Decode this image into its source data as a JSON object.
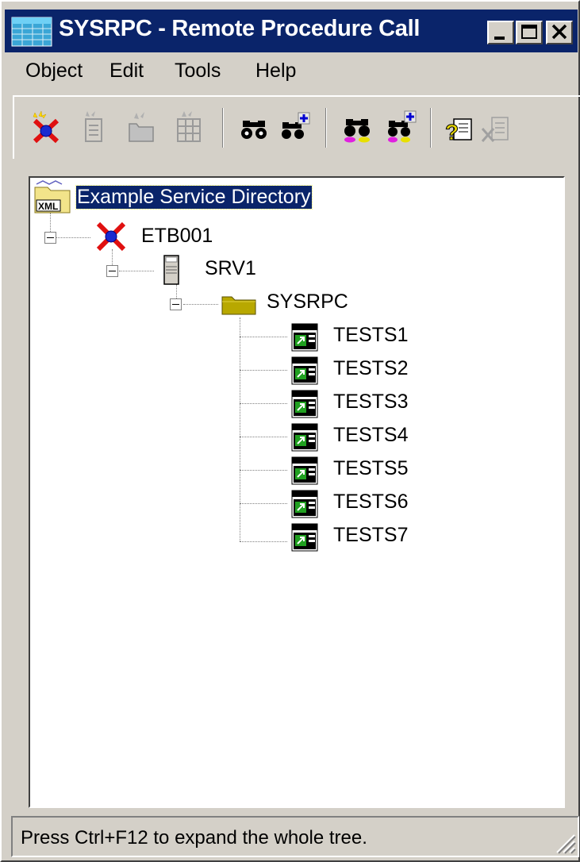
{
  "window": {
    "title": "SYSRPC - Remote Procedure Call"
  },
  "menu": [
    {
      "label": "Object"
    },
    {
      "label": "Edit"
    },
    {
      "label": "Tools"
    },
    {
      "label": "Help"
    }
  ],
  "toolbar": {
    "icons": [
      "new-broker-icon",
      "disabled-doc-icon",
      "disabled-folder-icon",
      "disabled-grid-icon",
      "binoculars-icon",
      "binoculars-add-icon",
      "binoculars-color-icon",
      "binoculars-color-add-icon",
      "help-icon",
      "disabled-close-icon"
    ]
  },
  "tree": {
    "root": {
      "label": "Example Service Directory",
      "icon": "xml-folder-icon"
    },
    "broker": {
      "label": "ETB001",
      "icon": "broker-icon"
    },
    "server": {
      "label": "SRV1",
      "icon": "server-icon"
    },
    "library": {
      "label": "SYSRPC",
      "icon": "folder-icon"
    },
    "programs": [
      {
        "label": "TESTS1"
      },
      {
        "label": "TESTS2"
      },
      {
        "label": "TESTS3"
      },
      {
        "label": "TESTS4"
      },
      {
        "label": "TESTS5"
      },
      {
        "label": "TESTS6"
      },
      {
        "label": "TESTS7"
      }
    ]
  },
  "status": {
    "text": "Press Ctrl+F12 to expand the whole tree."
  },
  "colors": {
    "title_bar": "#0a246a",
    "face": "#d4d0c8",
    "selection": "#0a246a"
  }
}
